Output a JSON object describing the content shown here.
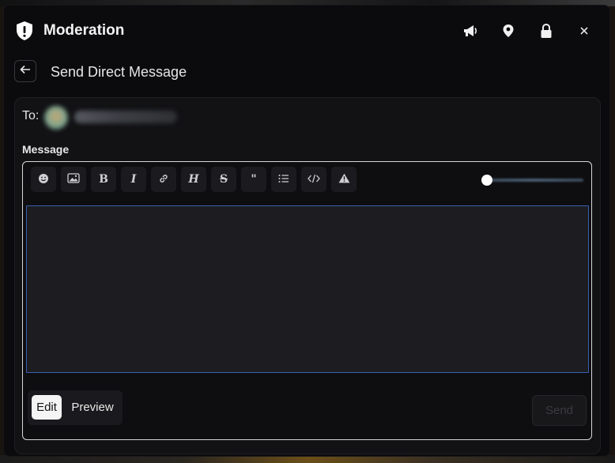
{
  "window": {
    "title": "Moderation",
    "icons": [
      "shield-alert-icon",
      "megaphone-icon",
      "location-pin-icon",
      "lock-icon",
      "close-icon"
    ],
    "close_label": "×"
  },
  "subheader": {
    "back_icon": "arrow-left-icon",
    "title": "Send Direct Message"
  },
  "form": {
    "to_label": "To:",
    "message_label": "Message",
    "toolbar": [
      {
        "name": "emoji-icon",
        "glyph": ""
      },
      {
        "name": "image-icon",
        "glyph": ""
      },
      {
        "name": "bold-button",
        "glyph": "B"
      },
      {
        "name": "italic-button",
        "glyph": "I"
      },
      {
        "name": "link-icon",
        "glyph": ""
      },
      {
        "name": "heading-button",
        "glyph": "H"
      },
      {
        "name": "strikethrough-button",
        "glyph": "S"
      },
      {
        "name": "quote-button",
        "glyph": "\""
      },
      {
        "name": "list-icon",
        "glyph": ""
      },
      {
        "name": "code-icon",
        "glyph": ""
      },
      {
        "name": "warning-icon",
        "glyph": ""
      }
    ],
    "message_value": "",
    "slider_value": 0,
    "modes": {
      "edit": "Edit",
      "preview": "Preview",
      "selected": "Edit"
    },
    "send_label": "Send"
  },
  "colors": {
    "background": "#0b0b0d",
    "panel": "#121215",
    "textarea_border": "#3a5fb0",
    "editor_border": "#d8d8d8"
  }
}
